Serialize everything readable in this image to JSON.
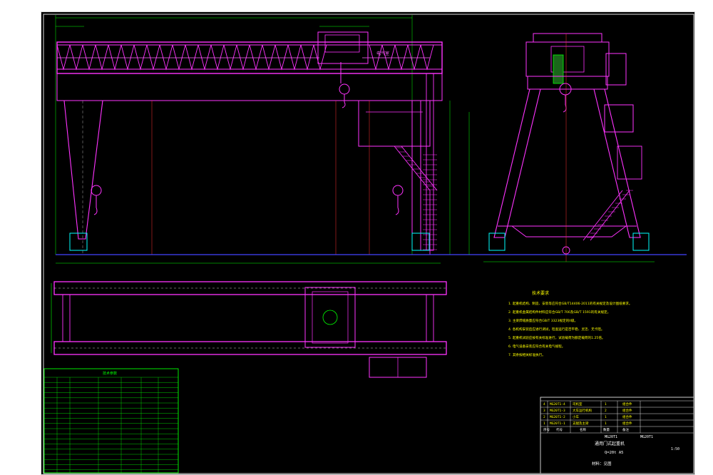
{
  "drawing": {
    "electric_room_label": "电气室",
    "notes_title": "技术要求",
    "notes": [
      "1. 起重机结构、制造、安装等应符合GB/T14406-2011的有关规定及设计图纸要求。",
      "2. 起重机金属结构件材料应符合GB/T 700及GB/T 1591的有关规定。",
      "3. 主梁焊缝质量应符合GB/T 3323规定的II级。",
      "4. 各机构安装后应进行调试，检查运行是否平稳、灵活、无卡阻。",
      "5. 起重机试验应按有关标准进行，试验载荷为额定载荷的1.25倍。",
      "6. 电气设备安装应符合有关电气规程。",
      "7. 其余按相关标准执行。"
    ],
    "params_title": "技术参数",
    "bom_rows": [
      [
        "4",
        "MG20T1-4",
        "司机室",
        "1",
        "组合件"
      ],
      [
        "3",
        "MG20T1-3",
        "大车运行机构",
        "2",
        "组合件"
      ],
      [
        "2",
        "MG20T1-2",
        "小车",
        "1",
        "组合件"
      ],
      [
        "1",
        "MG20T1-1",
        "支腿及主梁",
        "1",
        "组合件"
      ]
    ],
    "bom_header": [
      "序号",
      "代号",
      "名称",
      "数量",
      "备注"
    ],
    "title_block": {
      "code": "MG20T1",
      "name": "通用门式起重机",
      "spec": "Q=20t A5",
      "scale": "1:50",
      "material": "材料：见图"
    }
  }
}
